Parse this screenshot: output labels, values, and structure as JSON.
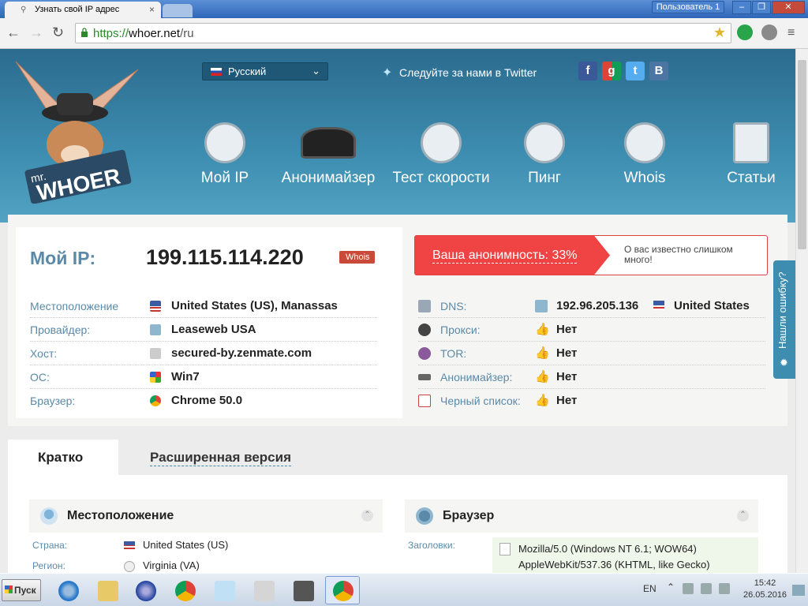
{
  "browser": {
    "tab_title": "Узнать свой IP адрес",
    "tab_close": "×",
    "user_badge": "Пользователь 1",
    "url_scheme": "https://",
    "url_host": "whoer.net",
    "url_path": "/ru",
    "window_min": "‒",
    "window_max": "❐",
    "window_close": "✕"
  },
  "header": {
    "language": "Русский",
    "twitter_text": "Следуйте за нами в Twitter",
    "social": [
      "f",
      "g",
      "t",
      "B"
    ],
    "logo_small": "mr.",
    "logo_big": "WHOER",
    "nav": [
      {
        "label": "Мой IP",
        "icon": "house-icon"
      },
      {
        "label": "Анонимайзер",
        "icon": "spy-hat-icon"
      },
      {
        "label": "Тест скорости",
        "icon": "speedometer-icon"
      },
      {
        "label": "Пинг",
        "icon": "radar-icon"
      },
      {
        "label": "Whois",
        "icon": "question-icon"
      },
      {
        "label": "Статьи",
        "icon": "document-icon"
      }
    ]
  },
  "ip_card": {
    "label": "Мой IP:",
    "ip": "199.115.114.220",
    "whois_tag": "Whois",
    "anonymity": "Ваша анонимность: 33%",
    "anonymity_percent": 33,
    "anonymity_note": "О вас известно слишком много!",
    "left_rows": [
      {
        "label": "Местоположение",
        "value": "United States (US), Manassas",
        "icon": "us-flag-icon"
      },
      {
        "label": "Провайдер:",
        "value": "Leaseweb USA",
        "icon": "provider-icon"
      },
      {
        "label": "Хост:",
        "value": "secured-by.zenmate.com",
        "icon": "server-icon"
      },
      {
        "label": "ОС:",
        "value": "Win7",
        "icon": "windows-icon"
      },
      {
        "label": "Браузер:",
        "value": "Chrome 50.0",
        "icon": "chrome-icon"
      }
    ],
    "right_rows": [
      {
        "label": "DNS:",
        "value": "192.96.205.136",
        "value2": "United States",
        "icon": "dns-icon"
      },
      {
        "label": "Прокси:",
        "value": "Нет",
        "icon": "spy-icon"
      },
      {
        "label": "TOR:",
        "value": "Нет",
        "icon": "onion-icon"
      },
      {
        "label": "Анонимайзер:",
        "value": "Нет",
        "icon": "glasses-icon"
      },
      {
        "label": "Черный список:",
        "value": "Нет",
        "icon": "list-icon"
      }
    ],
    "thumb": "👍"
  },
  "bug_report": "Нашли ошибку?",
  "tabs": {
    "short": "Кратко",
    "extended": "Расширенная версия"
  },
  "location_panel": {
    "title": "Местоположение",
    "country_label": "Страна:",
    "country_value": "United States (US)",
    "region_label": "Регион:",
    "region_value": "Virginia (VA)"
  },
  "browser_panel": {
    "title": "Браузер",
    "headers_label": "Заголовки:",
    "ua_line1": "Mozilla/5.0 (Windows NT 6.1; WOW64)",
    "ua_line2": "AppleWebKit/537.36 (KHTML, like Gecko)"
  },
  "taskbar": {
    "start": "Пуск",
    "lang": "EN",
    "time": "15:42",
    "date": "26.05.2016"
  }
}
